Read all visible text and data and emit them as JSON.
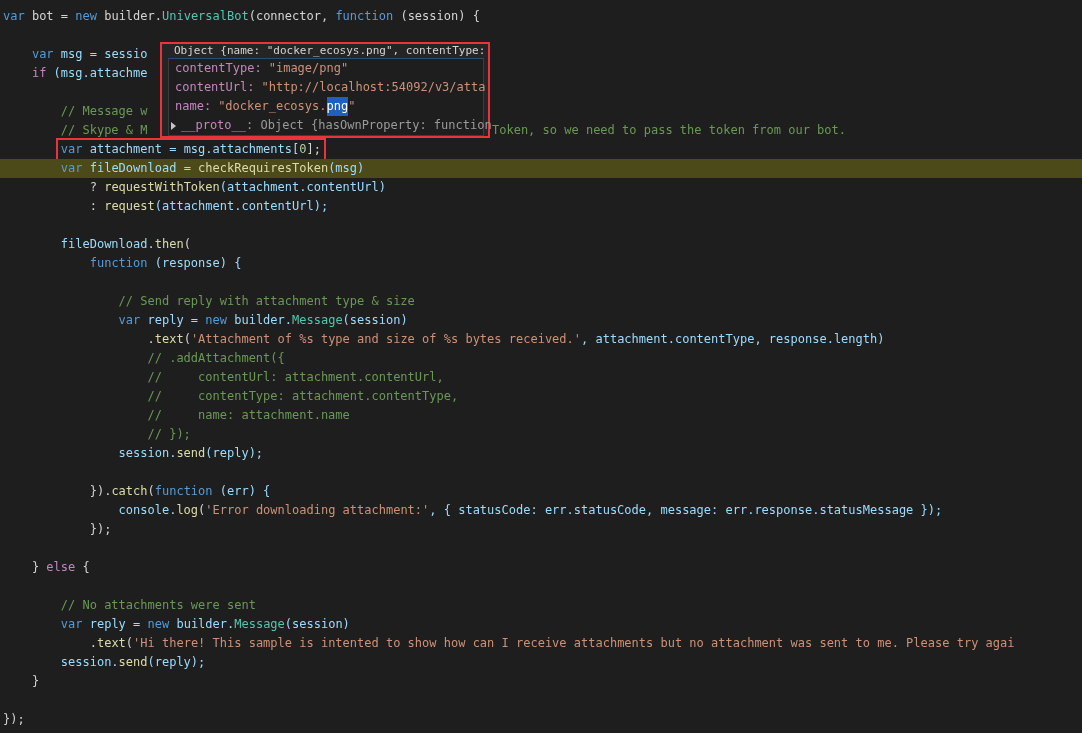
{
  "editor": {
    "lines": [
      {
        "kind": "code",
        "tokens": [
          {
            "text": "var",
            "kind": "kw"
          },
          {
            "text": " bot = ",
            "kind": "pl"
          },
          {
            "text": "new",
            "kind": "kw"
          },
          {
            "text": " builder.",
            "kind": "pl"
          },
          {
            "text": "UniversalBot",
            "kind": "cls"
          },
          {
            "text": "(connector, ",
            "kind": "pl"
          },
          {
            "text": "function",
            "kind": "kw"
          },
          {
            "text": " (session) {",
            "kind": "pl"
          }
        ]
      },
      {
        "kind": "blank"
      },
      {
        "kind": "code",
        "tokens": [
          {
            "text": "    var",
            "kind": "kw"
          },
          {
            "text": " msg = sessio",
            "kind": "var"
          }
        ]
      },
      {
        "kind": "code",
        "tokens": [
          {
            "text": "    if",
            "kind": "ctl"
          },
          {
            "text": " (msg.attachme",
            "kind": "var"
          }
        ]
      },
      {
        "kind": "blank"
      },
      {
        "kind": "code",
        "tokens": [
          {
            "text": "        // Message w",
            "kind": "cmt"
          }
        ]
      },
      {
        "kind": "code",
        "tokens": [
          {
            "text": "        // Skype & M",
            "kind": "cmt"
          }
        ],
        "after_tooltip": [
          {
            "text": "Token, so we need to pass the token from our bot.",
            "kind": "cmt"
          }
        ]
      },
      {
        "kind": "code",
        "boxed": true,
        "tokens": [
          {
            "text": "        var",
            "kind": "kw"
          },
          {
            "text": " attachment = msg.attachments[",
            "kind": "var"
          },
          {
            "text": "0",
            "kind": "num"
          },
          {
            "text": "];",
            "kind": "pl"
          }
        ]
      },
      {
        "kind": "code",
        "highlighted": true,
        "tokens": [
          {
            "text": "        var",
            "kind": "kw"
          },
          {
            "text": " fileDownload = ",
            "kind": "var"
          },
          {
            "text": "checkRequiresToken",
            "kind": "fn"
          },
          {
            "text": "(msg)",
            "kind": "var"
          }
        ]
      },
      {
        "kind": "code",
        "tokens": [
          {
            "text": "            ? ",
            "kind": "pl"
          },
          {
            "text": "requestWithToken",
            "kind": "fn"
          },
          {
            "text": "(attachment.contentUrl)",
            "kind": "var"
          }
        ]
      },
      {
        "kind": "code",
        "tokens": [
          {
            "text": "            : ",
            "kind": "pl"
          },
          {
            "text": "request",
            "kind": "fn"
          },
          {
            "text": "(attachment.contentUrl);",
            "kind": "var"
          }
        ]
      },
      {
        "kind": "blank"
      },
      {
        "kind": "code",
        "tokens": [
          {
            "text": "        fileDownload.",
            "kind": "var"
          },
          {
            "text": "then",
            "kind": "fn"
          },
          {
            "text": "(",
            "kind": "pl"
          }
        ]
      },
      {
        "kind": "code",
        "tokens": [
          {
            "text": "            function",
            "kind": "kw"
          },
          {
            "text": " (response) {",
            "kind": "var"
          }
        ]
      },
      {
        "kind": "blank"
      },
      {
        "kind": "code",
        "tokens": [
          {
            "text": "                // Send reply with attachment type & size",
            "kind": "cmt"
          }
        ]
      },
      {
        "kind": "code",
        "tokens": [
          {
            "text": "                var",
            "kind": "kw"
          },
          {
            "text": " reply = ",
            "kind": "var"
          },
          {
            "text": "new",
            "kind": "kw"
          },
          {
            "text": " builder.",
            "kind": "var"
          },
          {
            "text": "Message",
            "kind": "cls"
          },
          {
            "text": "(session)",
            "kind": "var"
          }
        ]
      },
      {
        "kind": "code",
        "tokens": [
          {
            "text": "                    .",
            "kind": "pl"
          },
          {
            "text": "text",
            "kind": "fn"
          },
          {
            "text": "(",
            "kind": "pl"
          },
          {
            "text": "'Attachment of %s type and size of %s bytes received.'",
            "kind": "str"
          },
          {
            "text": ", attachment.contentType, response.length)",
            "kind": "var"
          }
        ]
      },
      {
        "kind": "code",
        "tokens": [
          {
            "text": "                    // .addAttachment({",
            "kind": "cmt"
          }
        ]
      },
      {
        "kind": "code",
        "tokens": [
          {
            "text": "                    //     contentUrl: attachment.contentUrl,",
            "kind": "cmt"
          }
        ]
      },
      {
        "kind": "code",
        "tokens": [
          {
            "text": "                    //     contentType: attachment.contentType,",
            "kind": "cmt"
          }
        ]
      },
      {
        "kind": "code",
        "tokens": [
          {
            "text": "                    //     name: attachment.name",
            "kind": "cmt"
          }
        ]
      },
      {
        "kind": "code",
        "tokens": [
          {
            "text": "                    // });",
            "kind": "cmt"
          }
        ]
      },
      {
        "kind": "code",
        "tokens": [
          {
            "text": "                session.",
            "kind": "var"
          },
          {
            "text": "send",
            "kind": "fn"
          },
          {
            "text": "(reply);",
            "kind": "var"
          }
        ]
      },
      {
        "kind": "blank"
      },
      {
        "kind": "code",
        "tokens": [
          {
            "text": "            }).",
            "kind": "pl"
          },
          {
            "text": "catch",
            "kind": "fn"
          },
          {
            "text": "(",
            "kind": "pl"
          },
          {
            "text": "function",
            "kind": "kw"
          },
          {
            "text": " (err) {",
            "kind": "var"
          }
        ]
      },
      {
        "kind": "code",
        "tokens": [
          {
            "text": "                console.",
            "kind": "var"
          },
          {
            "text": "log",
            "kind": "fn"
          },
          {
            "text": "(",
            "kind": "pl"
          },
          {
            "text": "'Error downloading attachment:'",
            "kind": "str"
          },
          {
            "text": ", { statusCode: err.statusCode, message: err.response.statusMessage });",
            "kind": "var"
          }
        ]
      },
      {
        "kind": "code",
        "tokens": [
          {
            "text": "            });",
            "kind": "pl"
          }
        ]
      },
      {
        "kind": "blank"
      },
      {
        "kind": "code",
        "tokens": [
          {
            "text": "    } ",
            "kind": "pl"
          },
          {
            "text": "else",
            "kind": "ctl"
          },
          {
            "text": " {",
            "kind": "pl"
          }
        ]
      },
      {
        "kind": "blank"
      },
      {
        "kind": "code",
        "tokens": [
          {
            "text": "        // No attachments were sent",
            "kind": "cmt"
          }
        ]
      },
      {
        "kind": "code",
        "tokens": [
          {
            "text": "        var",
            "kind": "kw"
          },
          {
            "text": " reply = ",
            "kind": "var"
          },
          {
            "text": "new",
            "kind": "kw"
          },
          {
            "text": " builder.",
            "kind": "var"
          },
          {
            "text": "Message",
            "kind": "cls"
          },
          {
            "text": "(session)",
            "kind": "var"
          }
        ]
      },
      {
        "kind": "code",
        "tokens": [
          {
            "text": "            .",
            "kind": "pl"
          },
          {
            "text": "text",
            "kind": "fn"
          },
          {
            "text": "(",
            "kind": "pl"
          },
          {
            "text": "'Hi there! This sample is intented to show how can I receive attachments but no attachment was sent to me. Please try agai",
            "kind": "str"
          }
        ]
      },
      {
        "kind": "code",
        "tokens": [
          {
            "text": "        session.",
            "kind": "var"
          },
          {
            "text": "send",
            "kind": "fn"
          },
          {
            "text": "(reply);",
            "kind": "var"
          }
        ]
      },
      {
        "kind": "code",
        "tokens": [
          {
            "text": "    }",
            "kind": "pl"
          }
        ]
      },
      {
        "kind": "blank"
      },
      {
        "kind": "code",
        "tokens": [
          {
            "text": "});",
            "kind": "pl"
          }
        ]
      }
    ]
  },
  "tooltip": {
    "boxed": true,
    "header": "Object {name: \"docker_ecosys.png\", contentType:",
    "properties": [
      {
        "key": "contentType:",
        "value": "\"image/png\""
      },
      {
        "key": "contentUrl:",
        "value": "\"http://localhost:54092/v3/atta"
      },
      {
        "key": "name:",
        "value": "\"docker_ecosys.",
        "selection": "png",
        "value_end": "\""
      }
    ],
    "proto": {
      "key": "__proto__",
      "value": ": Object {hasOwnProperty: function",
      "expanded": false
    }
  }
}
